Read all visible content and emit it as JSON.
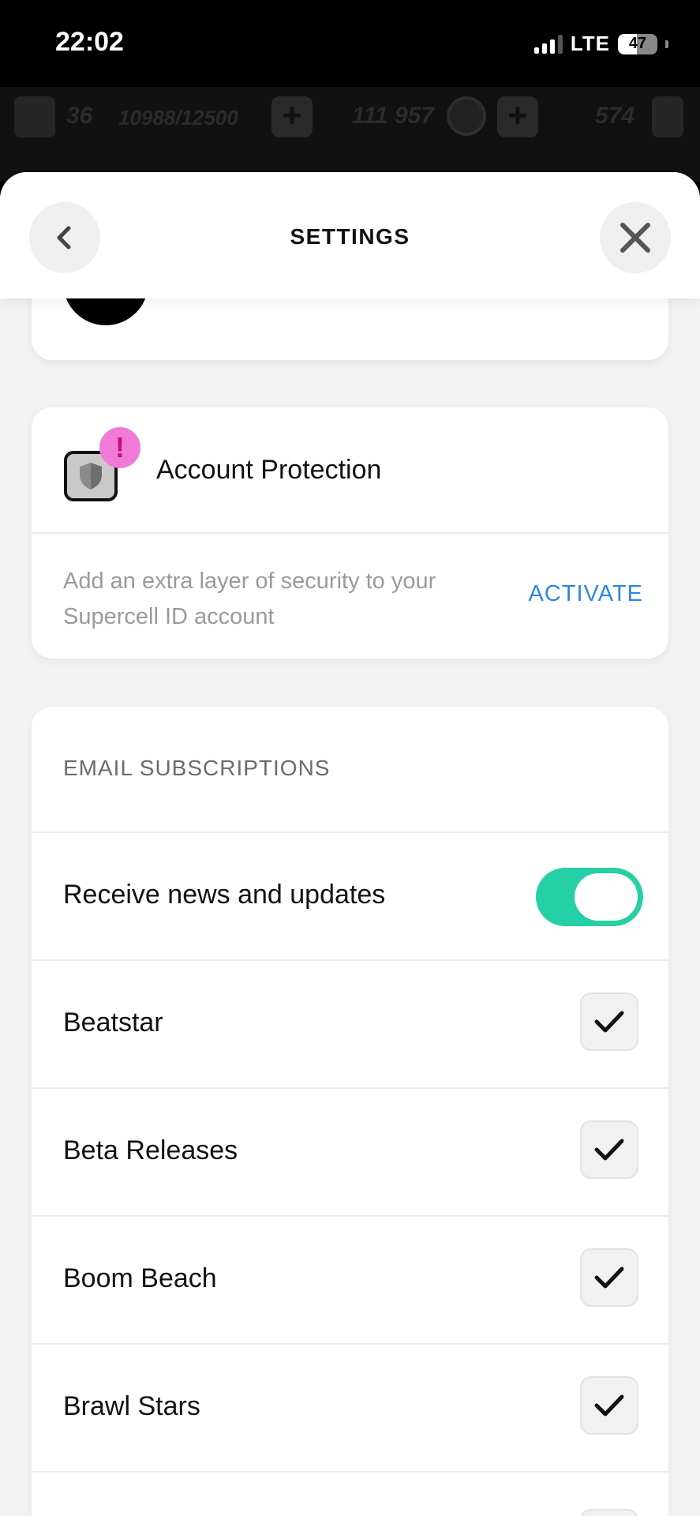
{
  "status_bar": {
    "time": "22:02",
    "network": "LTE",
    "battery": "47",
    "battery_level": 0.47
  },
  "game_bar": {
    "level": "36",
    "xp": "10988/12500",
    "coins": "111 957",
    "gems": "574"
  },
  "header": {
    "title": "SETTINGS",
    "back_icon": "chevron-left-icon",
    "close_icon": "close-icon"
  },
  "account_protection": {
    "title": "Account Protection",
    "alert": "!",
    "description": "Add an extra layer of security to your Supercell ID account",
    "action": "ACTIVATE",
    "icon": "shield-icon"
  },
  "email_subscriptions": {
    "heading": "EMAIL SUBSCRIPTIONS",
    "news_toggle": {
      "label": "Receive news and updates",
      "on": true
    },
    "games": [
      {
        "label": "Beatstar",
        "checked": true
      },
      {
        "label": "Beta Releases",
        "checked": true
      },
      {
        "label": "Boom Beach",
        "checked": true
      },
      {
        "label": "Brawl Stars",
        "checked": true
      }
    ]
  },
  "colors": {
    "accent": "#2f86e0",
    "toggle_on": "#25d0a6",
    "alert": "#f07ad6"
  }
}
